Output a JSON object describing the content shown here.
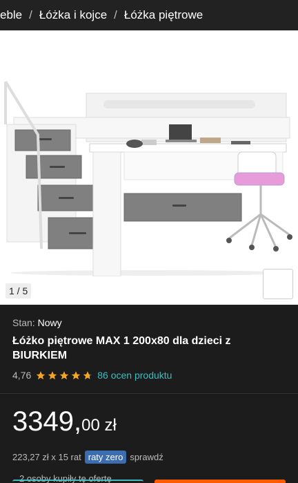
{
  "breadcrumb": {
    "items": [
      "eble",
      "Łóżka i kojce",
      "Łóżka piętrowe"
    ],
    "separator": "/"
  },
  "gallery": {
    "counter": "1 / 5",
    "favorite_icon": "heart-icon",
    "favorite_color": "#ff5a00"
  },
  "product": {
    "stan_label": "Stan:",
    "stan_value": "Nowy",
    "title": "Łóżko piętrowe MAX 1 200x80 dla dzieci z BIURKIEM",
    "rating": "4,76",
    "stars": 4.76,
    "reviews": "86 ocen produktu"
  },
  "price": {
    "integer": "3349,",
    "fraction": "00 zł",
    "installment_text": "223,27 zł x 15 rat",
    "badge": "raty zero",
    "check": "sprawdź",
    "bought": "2 osoby kupiły tę ofertę"
  },
  "colors": {
    "accent": "#3fbcc0",
    "brand": "#ff5a00",
    "star": "#f5a623"
  }
}
